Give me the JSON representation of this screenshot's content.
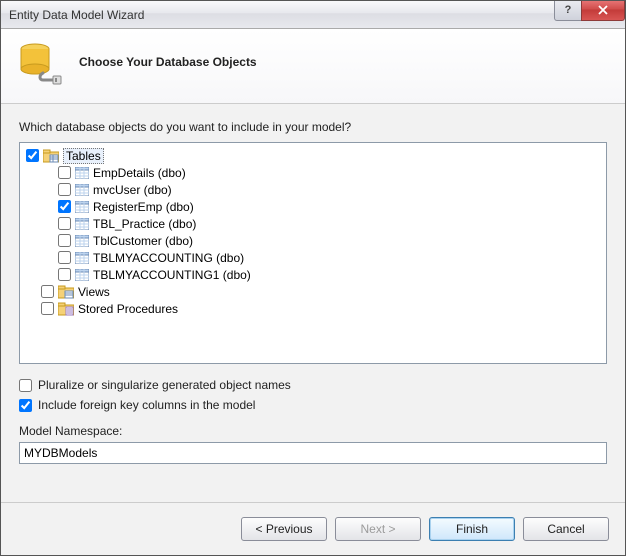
{
  "window": {
    "title": "Entity Data Model Wizard"
  },
  "header": {
    "heading": "Choose Your Database Objects"
  },
  "body": {
    "prompt": "Which database objects do you want to include in your model?",
    "roots": {
      "tables": "Tables",
      "views": "Views",
      "sprocs": "Stored Procedures"
    },
    "tables": [
      {
        "label": "EmpDetails (dbo)"
      },
      {
        "label": "mvcUser (dbo)"
      },
      {
        "label": "RegisterEmp (dbo)"
      },
      {
        "label": "TBL_Practice (dbo)"
      },
      {
        "label": "TblCustomer (dbo)"
      },
      {
        "label": "TBLMYACCOUNTING (dbo)"
      },
      {
        "label": "TBLMYACCOUNTING1 (dbo)"
      }
    ],
    "options": {
      "pluralize": "Pluralize or singularize generated object names",
      "foreignkeys": "Include foreign key columns in the model"
    },
    "namespace_label": "Model Namespace:",
    "namespace_value": "MYDBModels"
  },
  "footer": {
    "previous": "< Previous",
    "next": "Next >",
    "finish": "Finish",
    "cancel": "Cancel"
  }
}
